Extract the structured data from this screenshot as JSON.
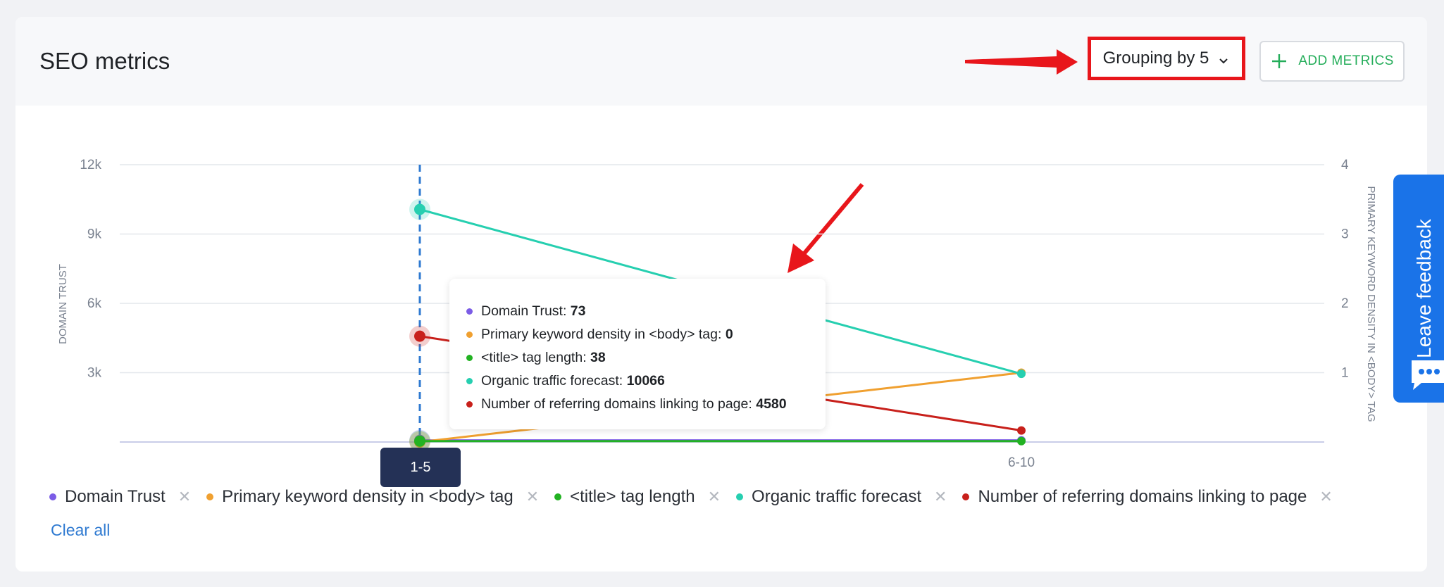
{
  "header": {
    "title": "SEO metrics",
    "grouping_label": "Grouping by 5",
    "add_metrics_label": "ADD METRICS"
  },
  "chart_data": {
    "type": "line",
    "categories": [
      "1-5",
      "6-10"
    ],
    "left_axis": {
      "label": "DOMAIN TRUST",
      "ticks": [
        "3k",
        "6k",
        "9k",
        "12k"
      ],
      "range": [
        0,
        12000
      ]
    },
    "right_axis": {
      "label": "PRIMARY KEYWORD DENSITY IN <BODY> TAG",
      "ticks": [
        "1",
        "2",
        "3",
        "4"
      ],
      "range": [
        0,
        4
      ]
    },
    "series": [
      {
        "name": "Domain Trust",
        "color": "#7b5ce6",
        "axis": "left",
        "values": [
          73,
          73
        ]
      },
      {
        "name": "Primary keyword density in <body> tag",
        "color": "#f0a030",
        "axis": "right",
        "values": [
          0,
          1
        ]
      },
      {
        "name": "<title> tag length",
        "color": "#22b222",
        "axis": "left",
        "values": [
          38,
          38
        ]
      },
      {
        "name": "Organic traffic forecast",
        "color": "#26cfb0",
        "axis": "left",
        "values": [
          10066,
          2950
        ]
      },
      {
        "name": "Number of referring domains linking to page",
        "color": "#c8201b",
        "axis": "left",
        "values": [
          4580,
          500
        ]
      }
    ],
    "grid": true,
    "legend_position": "bottom-left"
  },
  "tooltip": {
    "category": "1-5",
    "rows": [
      {
        "label": "Domain Trust:",
        "value": "73",
        "color": "#7b5ce6"
      },
      {
        "label": "Primary keyword density in <body> tag:",
        "value": "0",
        "color": "#f0a030"
      },
      {
        "label": "<title> tag length:",
        "value": "38",
        "color": "#22b222"
      },
      {
        "label": "Organic traffic forecast:",
        "value": "10066",
        "color": "#26cfb0"
      },
      {
        "label": "Number of referring domains linking to page:",
        "value": "4580",
        "color": "#c8201b"
      }
    ]
  },
  "legend": {
    "clear_all_label": "Clear all"
  },
  "feedback": {
    "label": "Leave feedback"
  }
}
